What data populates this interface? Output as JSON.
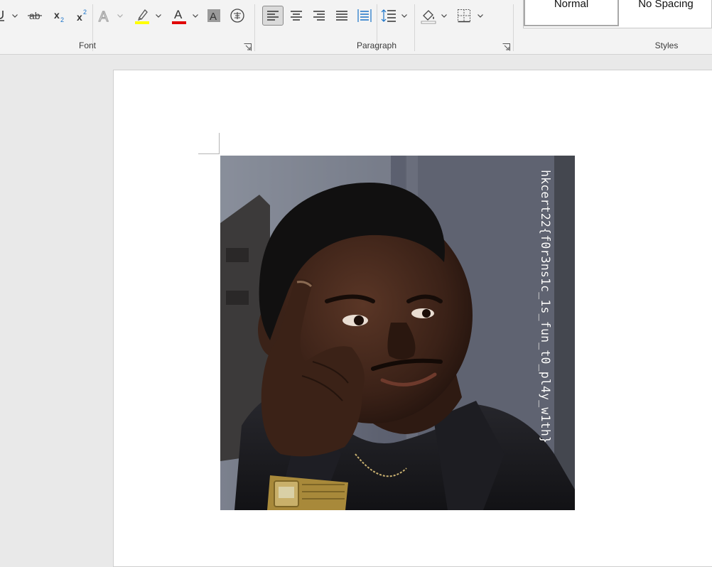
{
  "ribbon": {
    "font_group": {
      "label": "Font",
      "buttons": [
        {
          "name": "underline-button"
        },
        {
          "name": "strikethrough-button"
        },
        {
          "name": "subscript-button",
          "glyph": "x"
        },
        {
          "name": "superscript-button",
          "glyph": "x"
        },
        {
          "name": "text-effects-button",
          "glyph": "A"
        },
        {
          "name": "highlight-color-button",
          "color": "#ffff00"
        },
        {
          "name": "font-color-button",
          "glyph": "A",
          "color": "#e00000"
        },
        {
          "name": "character-shading-button",
          "glyph": "A"
        },
        {
          "name": "enclose-characters-button",
          "glyph": "字"
        }
      ]
    },
    "paragraph_group": {
      "label": "Paragraph",
      "buttons": [
        {
          "name": "align-left-button",
          "active": true
        },
        {
          "name": "center-button"
        },
        {
          "name": "align-right-button"
        },
        {
          "name": "justify-button"
        },
        {
          "name": "distributed-button"
        },
        {
          "name": "line-spacing-button"
        },
        {
          "name": "shading-button"
        },
        {
          "name": "borders-button"
        }
      ]
    },
    "styles_group": {
      "label": "Styles",
      "items": [
        {
          "label": "Normal",
          "selected": true
        },
        {
          "label": "No Spacing"
        }
      ]
    }
  },
  "document": {
    "image": {
      "description_icon": "meme-photo",
      "overlay_text": "hkcert22{f0r3ns1c_1s_fun_t0_pl4y_w1th}"
    }
  }
}
